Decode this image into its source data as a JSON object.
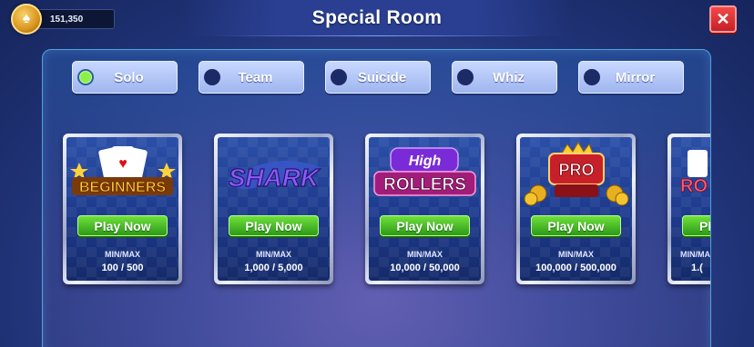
{
  "header": {
    "balance": "151,350",
    "title": "Special Room",
    "close_label": "✕",
    "coin_icon": "spade-coin-icon"
  },
  "tabs": [
    {
      "label": "Solo",
      "active": true
    },
    {
      "label": "Team",
      "active": false
    },
    {
      "label": "Suicide",
      "active": false
    },
    {
      "label": "Whiz",
      "active": false
    },
    {
      "label": "Mirror",
      "active": false
    }
  ],
  "rooms": [
    {
      "name": "BEGINNERS",
      "button": "Play Now",
      "minmax_label": "MIN/MAX",
      "minmax": "100 / 500"
    },
    {
      "name": "SHARK",
      "button": "Play Now",
      "minmax_label": "MIN/MAX",
      "minmax": "1,000 / 5,000"
    },
    {
      "name_top": "High",
      "name_bottom": "ROLLERS",
      "button": "Play Now",
      "minmax_label": "MIN/MAX",
      "minmax": "10,000 / 50,000"
    },
    {
      "name": "PRO",
      "button": "Play Now",
      "minmax_label": "MIN/MAX",
      "minmax": "100,000 / 500,000"
    },
    {
      "name": "RO",
      "button": "Pl",
      "minmax_label": "MIN/MAX",
      "minmax": "1.("
    }
  ],
  "colors": {
    "play_button": "#4cc22a",
    "active_radio": "#8cf04a",
    "close_button": "#e0333a"
  }
}
